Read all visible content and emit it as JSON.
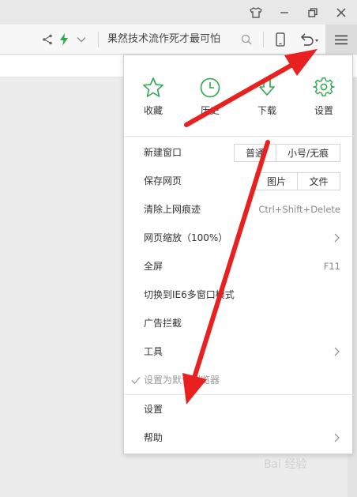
{
  "toolbar": {
    "search_text": "果然技术流作死才最可怕"
  },
  "quick_actions": [
    {
      "label": "收藏",
      "icon": "star-icon"
    },
    {
      "label": "历史",
      "icon": "clock-icon"
    },
    {
      "label": "下载",
      "icon": "download-icon"
    },
    {
      "label": "设置",
      "icon": "gear-icon"
    }
  ],
  "menu": {
    "new_window": {
      "label": "新建窗口",
      "normal": "普通",
      "incognito": "小号/无痕"
    },
    "save_page": {
      "label": "保存网页",
      "image": "图片",
      "file": "文件"
    },
    "clear_history": {
      "label": "清除上网痕迹",
      "shortcut": "Ctrl+Shift+Delete"
    },
    "zoom": {
      "label": "网页缩放（100%）"
    },
    "fullscreen": {
      "label": "全屏",
      "shortcut": "F11"
    },
    "ie6_mode": {
      "label": "切换到IE6多窗口模式"
    },
    "adblock": {
      "label": "广告拦截"
    },
    "tools": {
      "label": "工具"
    },
    "set_default": {
      "label": "设置为默认浏览器"
    },
    "settings": {
      "label": "设置"
    },
    "help": {
      "label": "帮助"
    }
  },
  "watermark": "Bai 经验",
  "colors": {
    "accent_green": "#2aa84a",
    "arrow_red": "#e8201f"
  }
}
